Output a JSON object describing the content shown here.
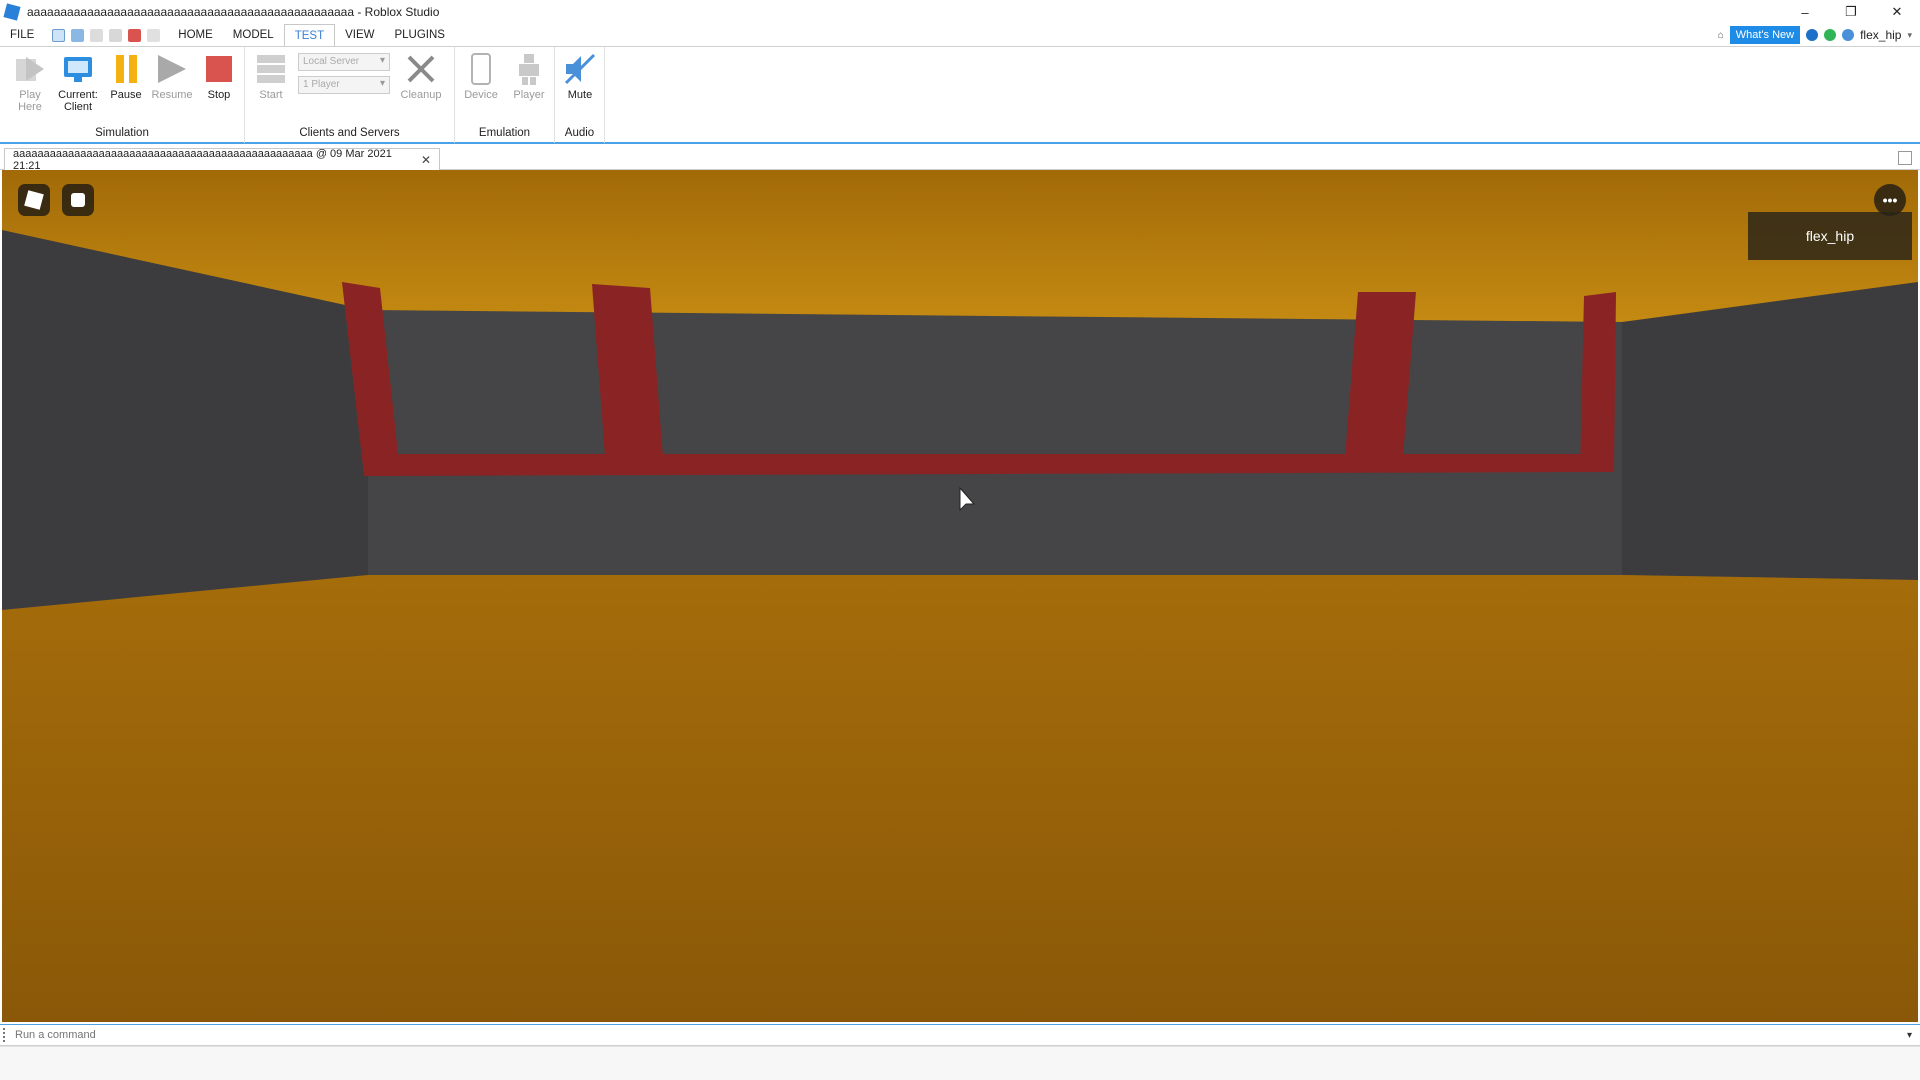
{
  "window": {
    "title": "aaaaaaaaaaaaaaaaaaaaaaaaaaaaaaaaaaaaaaaaaaaaaaaaa - Roblox Studio",
    "minimize": "–",
    "maximize": "❐",
    "close": "✕"
  },
  "menu": {
    "items": [
      "FILE",
      "HOME",
      "MODEL",
      "TEST",
      "VIEW",
      "PLUGINS"
    ],
    "active": "TEST",
    "whats_new": "What's New",
    "username": "flex_hip"
  },
  "ribbon": {
    "simulation": {
      "label": "Simulation",
      "play_here": "Play",
      "play_here_2": "Here",
      "current_client": "Current:",
      "current_client_2": "Client",
      "pause": "Pause",
      "resume": "Resume",
      "stop": "Stop"
    },
    "clients_servers": {
      "label": "Clients and Servers",
      "start": "Start",
      "server_select": "Local Server",
      "players_select": "1 Player",
      "cleanup": "Cleanup"
    },
    "emulation": {
      "label": "Emulation",
      "device": "Device",
      "player": "Player"
    },
    "audio": {
      "label": "Audio",
      "mute": "Mute"
    }
  },
  "doc_tab": {
    "label": "aaaaaaaaaaaaaaaaaaaaaaaaaaaaaaaaaaaaaaaaaaaaaaaaa @ 09 Mar 2021 21:21",
    "close": "✕"
  },
  "viewport": {
    "player_name": "flex_hip",
    "colors": {
      "floor": "#b8780a",
      "ceiling": "#c88a0e",
      "wall": "#3e3e40",
      "brick": "#8a2424"
    }
  },
  "command_bar": {
    "placeholder": "Run a command"
  }
}
